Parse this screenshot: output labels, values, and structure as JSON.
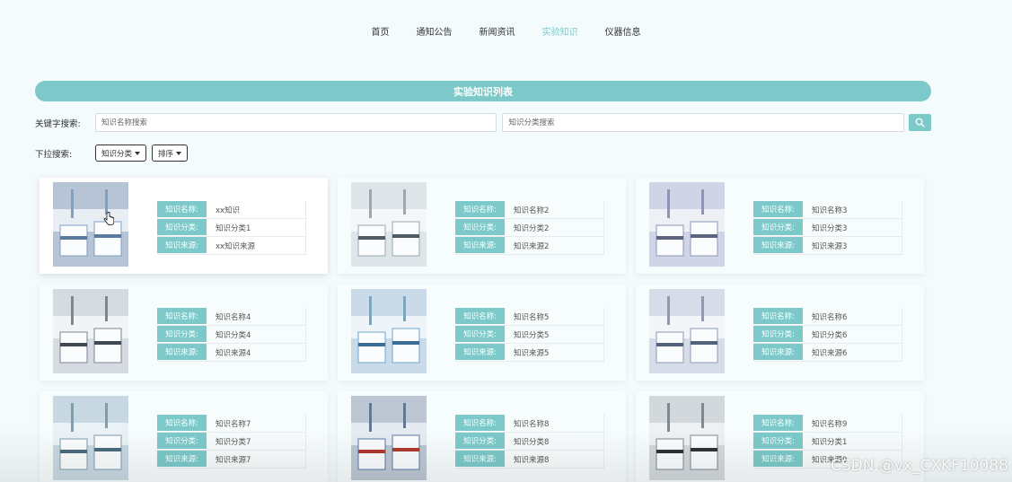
{
  "nav": {
    "items": [
      {
        "label": "首页"
      },
      {
        "label": "通知公告"
      },
      {
        "label": "新闻资讯"
      },
      {
        "label": "实验知识",
        "active": true
      },
      {
        "label": "仪器信息"
      }
    ]
  },
  "page_title": "实验知识列表",
  "search": {
    "keyword_label": "关键字搜索:",
    "name_placeholder": "知识名称搜索",
    "category_placeholder": "知识分类搜索",
    "button_icon": "search-icon"
  },
  "dropdowns": {
    "label": "下拉搜索:",
    "category_label": "知识分类",
    "sort_label": "排序"
  },
  "field_labels": {
    "name": "知识名称:",
    "category": "知识分类:",
    "source": "知识来源:"
  },
  "cards": [
    {
      "name": "xx知识",
      "category": "知识分类1",
      "source": "xx知识来源"
    },
    {
      "name": "知识名称2",
      "category": "知识分类2",
      "source": "知识来源2"
    },
    {
      "name": "知识名称3",
      "category": "知识分类3",
      "source": "知识来源3"
    },
    {
      "name": "知识名称4",
      "category": "知识分类4",
      "source": "知识来源4"
    },
    {
      "name": "知识名称5",
      "category": "知识分类5",
      "source": "知识来源5"
    },
    {
      "name": "知识名称6",
      "category": "知识分类6",
      "source": "知识来源6"
    },
    {
      "name": "知识名称7",
      "category": "知识分类7",
      "source": "知识来源7"
    },
    {
      "name": "知识名称8",
      "category": "知识分类8",
      "source": "知识来源8"
    },
    {
      "name": "知识名称9",
      "category": "知识分类1",
      "source": "知识来源9"
    }
  ],
  "watermark": "CSDN @vx_CXKF10088",
  "colors": {
    "accent": "#7dc9c9",
    "background": "#f4fbfc",
    "nav_active": "#7ccbcb"
  }
}
